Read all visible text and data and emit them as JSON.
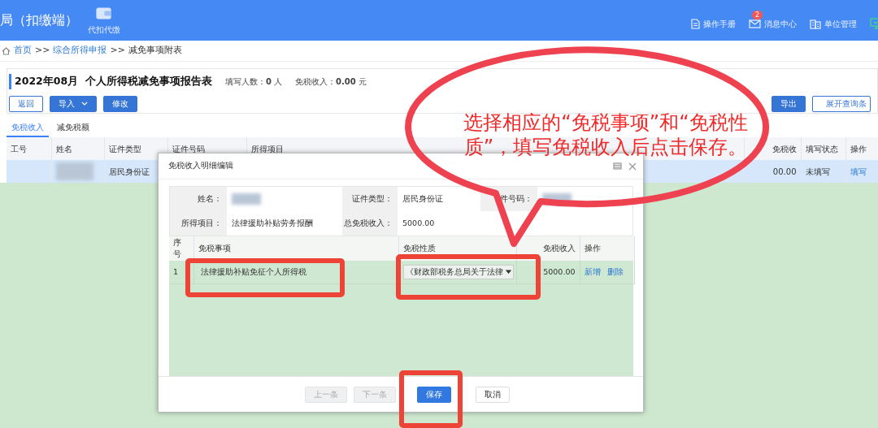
{
  "header": {
    "title": "局（扣缴端）",
    "nav": [
      {
        "label": "代扣代缴"
      }
    ],
    "tools": [
      {
        "kind": "doc",
        "label": "操作手册"
      },
      {
        "kind": "mail",
        "label": "消息中心",
        "badge": "2"
      },
      {
        "kind": "building",
        "label": "单位管理"
      },
      {
        "kind": "monitor"
      }
    ]
  },
  "breadcrumb": {
    "separator": ">>",
    "items": [
      {
        "label": "首页",
        "link": true
      },
      {
        "label": "综合所得申报",
        "link": true
      },
      {
        "label": "减免事项附表",
        "link": false
      }
    ]
  },
  "report": {
    "title": "2022年08月  个人所得税减免事项报告表",
    "stats": [
      "填写人数：**0** 人",
      "免税收入：**0.00** 元"
    ]
  },
  "toolbar": {
    "left": [
      {
        "label": "返回",
        "kind": "outline"
      },
      {
        "label": "导入",
        "kind": "dropdown"
      },
      {
        "label": "修改",
        "kind": "primary"
      }
    ],
    "right": [
      {
        "label": "导出",
        "kind": "primary"
      },
      {
        "label": "展开查询条",
        "kind": "outline"
      }
    ]
  },
  "tabs": [
    {
      "label": "免税收入",
      "selected": true
    },
    {
      "label": "减免税额",
      "selected": false
    }
  ],
  "table": {
    "columns": [
      "工号",
      "姓名",
      "证件类型",
      "证件号码",
      "所得项目",
      "免税收",
      "填写状态",
      "操作"
    ],
    "rows": [
      {
        "selected": true,
        "cells": [
          {
            "kind": "empty"
          },
          {
            "kind": "redacted"
          },
          {
            "kind": "text",
            "text": "居民身份证"
          },
          {
            "kind": "empty"
          },
          {
            "kind": "empty"
          },
          {
            "kind": "number",
            "text": "00.00"
          },
          {
            "kind": "text",
            "text": "未填写"
          },
          {
            "kind": "link",
            "text": "填写"
          }
        ]
      }
    ]
  },
  "modal": {
    "title": "免税收入明细编辑",
    "info": [
      {
        "label": "姓名：",
        "kind": "redacted"
      },
      {
        "label": "证件类型：",
        "kind": "text",
        "value": "居民身份证"
      },
      {
        "label": "件号码：",
        "kind": "redacted"
      },
      {
        "label": "所得项目：",
        "kind": "text",
        "value": "法律援助补贴劳务报酬"
      },
      {
        "label": "总免税收入：",
        "kind": "text",
        "value": "5000.00"
      }
    ],
    "columns": [
      "序号",
      "免税事项",
      "免税性质",
      "免税收入",
      "操作"
    ],
    "rows": [
      {
        "index": "1",
        "item": "法律援助补贴免征个人所得税",
        "nature": "《财政部税务总局关于法律",
        "income": "5000.00",
        "actions": [
          "新增",
          "删除"
        ]
      }
    ],
    "buttons": [
      {
        "label": "上一条",
        "kind": "default",
        "disabled": true
      },
      {
        "label": "下一条",
        "kind": "default",
        "disabled": true
      },
      {
        "label": "保存",
        "kind": "primary",
        "disabled": false
      },
      {
        "label": "取消",
        "kind": "default",
        "disabled": false
      }
    ]
  },
  "annotation": {
    "text": "选择相应的“免税事项”和“免税性质”，填写免税收入后点击保存。"
  }
}
